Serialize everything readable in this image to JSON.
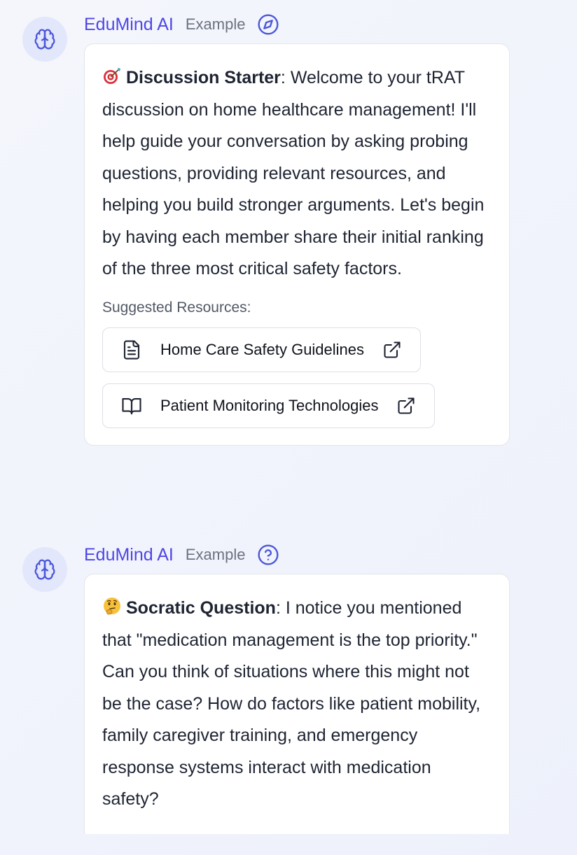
{
  "messages": [
    {
      "sender": "EduMind AI",
      "tag": "Example",
      "type_icon": "compass-icon",
      "emoji": "direct-hit-target-emoji",
      "lead": "Discussion Starter",
      "text": ": Welcome to your tRAT discussion on home healthcare management! I'll help guide your conversation by asking probing questions, providing relevant resources, and helping you build stronger arguments. Let's begin by having each member share their initial ranking of the three most critical safety factors.",
      "resources_label": "Suggested Resources:",
      "resources": [
        {
          "icon": "document-icon",
          "label": "Home Care Safety Guidelines"
        },
        {
          "icon": "book-open-icon",
          "label": "Patient Monitoring Technologies"
        }
      ]
    },
    {
      "sender": "EduMind AI",
      "tag": "Example",
      "type_icon": "question-circle-icon",
      "emoji": "thinking-face-emoji",
      "lead": "Socratic Question",
      "text": ": I notice you mentioned that \"medication management is the top priority.\" Can you think of situations where this might not be the case? How do factors like patient mobility, family caregiver training, and emergency response systems interact with medication safety?"
    }
  ],
  "colors": {
    "accent": "#4f46e5",
    "avatar_bg": "#e3e7fb",
    "icon_blue": "#4b57d8"
  }
}
